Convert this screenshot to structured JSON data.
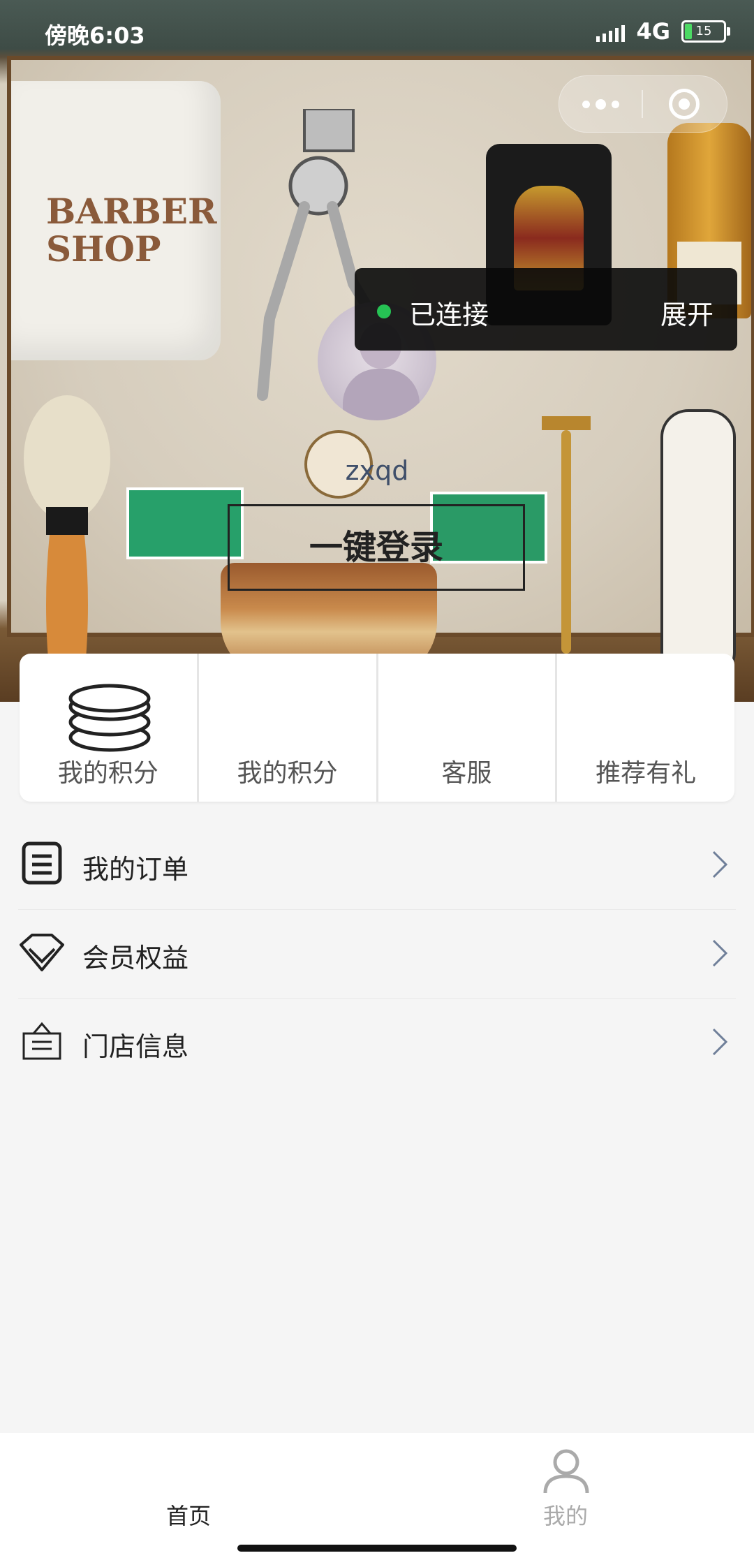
{
  "status_bar": {
    "time": "傍晚6:03",
    "network": "4G",
    "battery": "15"
  },
  "capsule": {
    "more_icon": "more-dots-icon",
    "close_icon": "target-close-icon"
  },
  "hero": {
    "towel_text_line1": "BARBER",
    "towel_text_line2": "SHOP",
    "connection_status": "已连接",
    "connection_expand": "展开",
    "username": "zxqd",
    "login_button": "一键登录"
  },
  "quick_actions": [
    {
      "label": "我的积分",
      "icon": "coins-icon"
    },
    {
      "label": "我的积分"
    },
    {
      "label": "客服"
    },
    {
      "label": "推荐有礼"
    }
  ],
  "menu": [
    {
      "label": "我的订单",
      "icon": "order-list-icon"
    },
    {
      "label": "会员权益",
      "icon": "diamond-icon"
    },
    {
      "label": "门店信息",
      "icon": "store-sign-icon"
    }
  ],
  "tab_bar": {
    "home": "首页",
    "mine": "我的"
  },
  "colors": {
    "connected_dot": "#26c254",
    "background": "#f5f5f5",
    "active_tab": "#222222",
    "inactive_tab": "#aaaaaa"
  }
}
